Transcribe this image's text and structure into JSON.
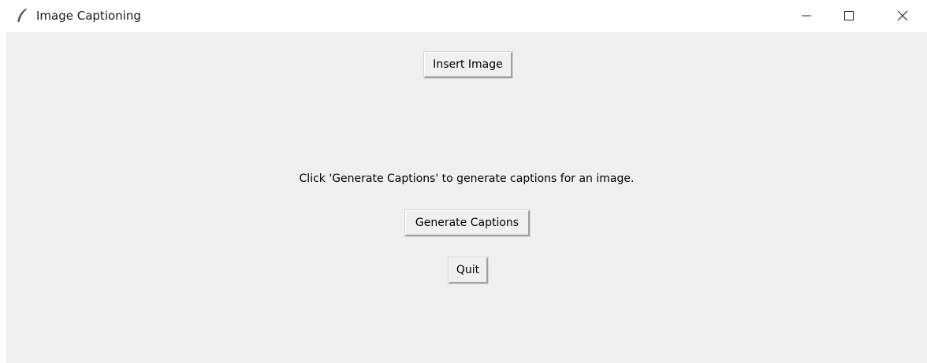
{
  "window": {
    "title": "Image Captioning",
    "app_icon": "feather-icon",
    "controls": {
      "minimize_icon": "minimize-icon",
      "maximize_icon": "maximize-icon",
      "close_icon": "close-icon"
    }
  },
  "main": {
    "insert_button_label": "Insert Image",
    "instruction_text": "Click 'Generate Captions' to generate captions for an image.",
    "generate_button_label": "Generate Captions",
    "quit_button_label": "Quit"
  },
  "colors": {
    "client_background": "#f0f0f0",
    "titlebar_background": "#ffffff",
    "text": "#000000"
  }
}
